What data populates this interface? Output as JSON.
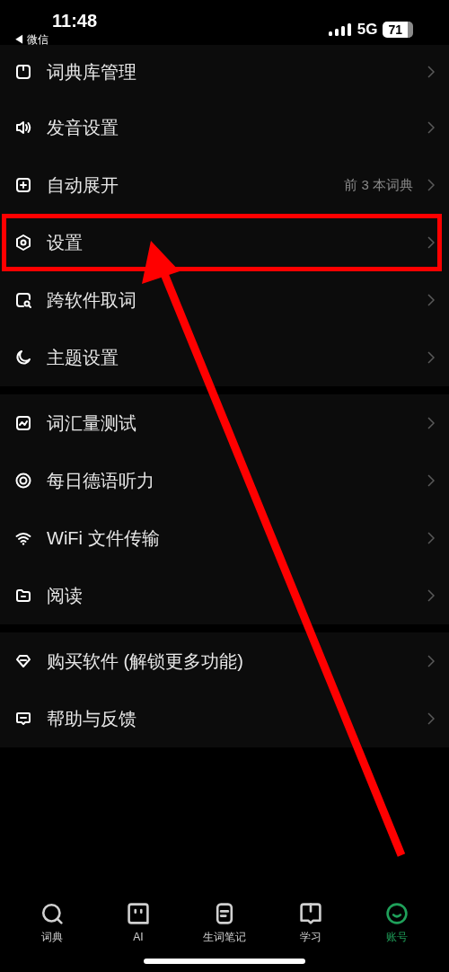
{
  "status_bar": {
    "time": "11:48",
    "back_label": "◀ 微信",
    "network": "5G",
    "battery": "71"
  },
  "sections": [
    {
      "items": [
        {
          "label": "词典库管理",
          "highlighted": false
        },
        {
          "label": "发音设置",
          "highlighted": false
        },
        {
          "label": "自动展开",
          "value": "前 3 本词典",
          "highlighted": false
        },
        {
          "label": "设置",
          "highlighted": true
        },
        {
          "label": "跨软件取词",
          "highlighted": false
        },
        {
          "label": "主题设置",
          "highlighted": false
        }
      ]
    },
    {
      "items": [
        {
          "label": "词汇量测试",
          "highlighted": false
        },
        {
          "label": "每日德语听力",
          "highlighted": false
        },
        {
          "label": "WiFi 文件传输",
          "highlighted": false
        },
        {
          "label": "阅读",
          "highlighted": false
        }
      ]
    },
    {
      "items": [
        {
          "label": "购买软件 (解锁更多功能)",
          "highlighted": false
        },
        {
          "label": "帮助与反馈",
          "highlighted": false
        }
      ]
    }
  ],
  "tabs": [
    {
      "label": "词典",
      "selected": false
    },
    {
      "label": "AI",
      "selected": false
    },
    {
      "label": "生词笔记",
      "selected": false
    },
    {
      "label": "学习",
      "selected": false
    },
    {
      "label": "账号",
      "selected": true
    }
  ]
}
